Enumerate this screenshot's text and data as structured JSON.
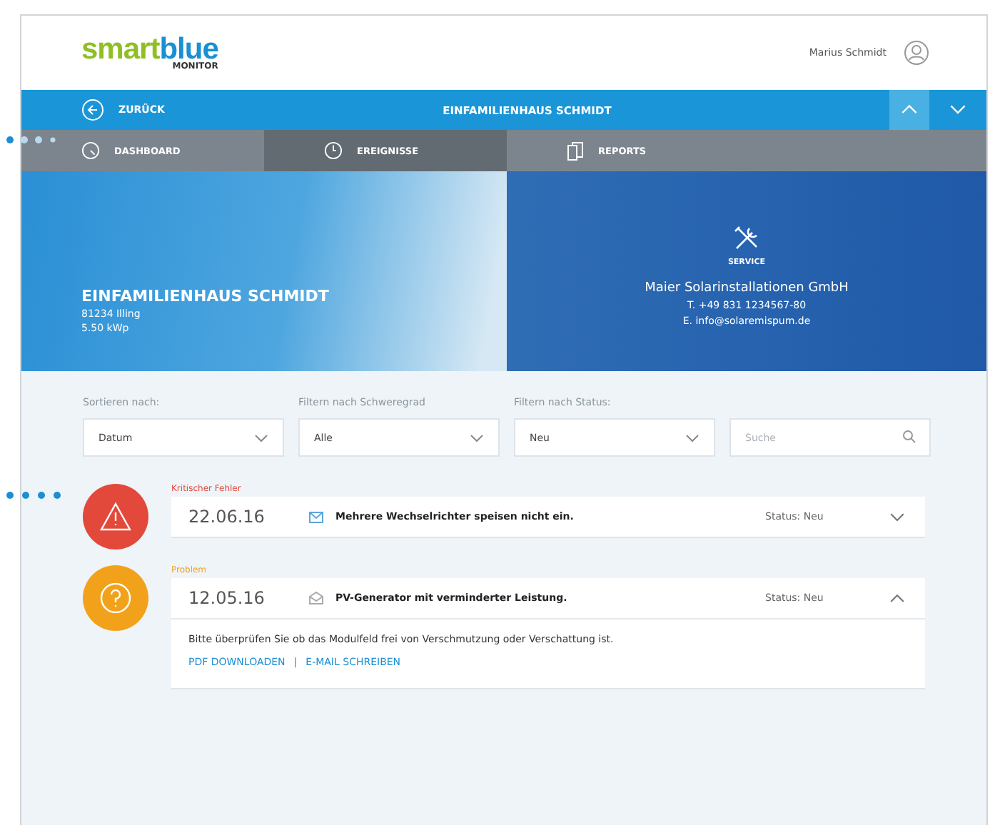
{
  "header": {
    "logo": {
      "brand_left": "smart",
      "brand_right": "blue",
      "sub": "MONITOR"
    },
    "user_name": "Marius Schmidt"
  },
  "nav_bar": {
    "back_label": "ZURÜCK",
    "title": "EINFAMILIENHAUS SCHMIDT",
    "arrows": [
      {
        "kind": "up",
        "selected": true
      },
      {
        "kind": "down",
        "selected": false
      }
    ]
  },
  "tabs": [
    {
      "kind": "dashboard",
      "label": "DASHBOARD",
      "selected": false
    },
    {
      "kind": "events",
      "label": "EREIGNISSE",
      "selected": true
    },
    {
      "kind": "reports",
      "label": "REPORTS",
      "selected": false
    }
  ],
  "hero": {
    "title": "EINFAMILIENHAUS SCHMIDT",
    "address": "81234 Illing",
    "power": "5.50 kWp",
    "service": {
      "label": "SERVICE",
      "company": "Maier Solarinstallationen GmbH",
      "phone": "T. +49 831 1234567-80",
      "email": "E. info@solaremispum.de"
    }
  },
  "filters": [
    {
      "kind": "select",
      "label": "Sortieren nach:",
      "value": "Datum"
    },
    {
      "kind": "select",
      "label": "Filtern nach Schweregrad",
      "value": "Alle"
    },
    {
      "kind": "select",
      "label": "Filtern nach Status:",
      "value": "Neu"
    },
    {
      "kind": "search",
      "placeholder": "Suche"
    }
  ],
  "events": [
    {
      "kind": "critical",
      "category": "Kritischer Fehler",
      "date": "22.06.16",
      "read": false,
      "message": "Mehrere Wechselrichter speisen nicht ein.",
      "status": "Status: Neu",
      "expanded": false
    },
    {
      "kind": "problem",
      "category": "Problem",
      "date": "12.05.16",
      "read": true,
      "message": "PV-Generator mit verminderter Leistung.",
      "status": "Status: Neu",
      "expanded": true,
      "details": "Bitte überprüfen Sie ob das Modulfeld frei von Verschmutzung oder Verschattung ist.",
      "links": [
        "PDF DOWNLOADEN",
        "E-MAIL SCHREIBEN"
      ],
      "link_separator": "|"
    }
  ]
}
